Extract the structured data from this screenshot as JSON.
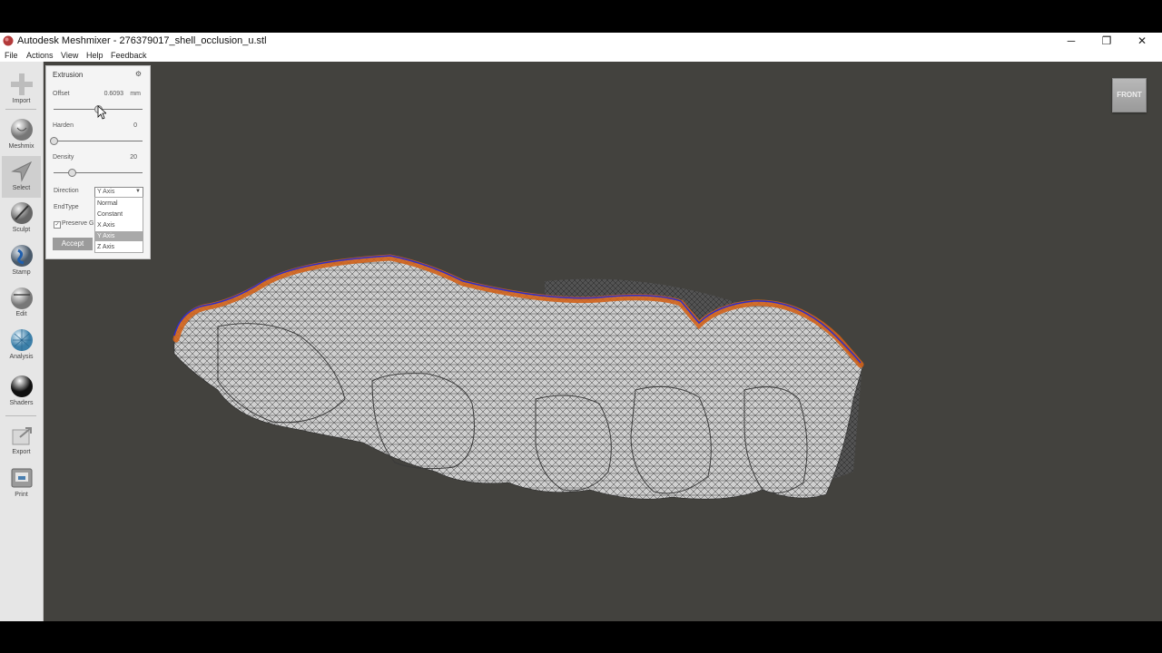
{
  "window": {
    "title": "Autodesk Meshmixer - 276379017_shell_occlusion_u.stl",
    "controls": {
      "minimize": "─",
      "restore": "❐",
      "close": "✕"
    }
  },
  "menu": [
    "File",
    "Actions",
    "View",
    "Help",
    "Feedback"
  ],
  "toolbar": [
    {
      "label": "Import",
      "icon": "plus-icon"
    },
    {
      "label": "Meshmix",
      "icon": "meshmix-sphere-icon"
    },
    {
      "label": "Select",
      "icon": "select-arrow-icon"
    },
    {
      "label": "Sculpt",
      "icon": "brush-icon"
    },
    {
      "label": "Stamp",
      "icon": "stamp-icon"
    },
    {
      "label": "Edit",
      "icon": "edit-sphere-icon"
    },
    {
      "label": "Analysis",
      "icon": "analysis-sphere-icon"
    },
    {
      "label": "Shaders",
      "icon": "shaders-sphere-icon"
    },
    {
      "label": "Export",
      "icon": "export-icon"
    },
    {
      "label": "Print",
      "icon": "printer-icon"
    }
  ],
  "panel": {
    "title": "Extrusion",
    "offset": {
      "label": "Offset",
      "value": "0.6093",
      "unit": "mm",
      "slider": 0.5
    },
    "harden": {
      "label": "Harden",
      "value": "0",
      "slider": 0.0
    },
    "density": {
      "label": "Density",
      "value": "20",
      "slider": 0.2
    },
    "direction": {
      "label": "Direction",
      "selected": "Y Axis",
      "options": [
        "Normal",
        "Constant",
        "X Axis",
        "Y Axis",
        "Z Axis"
      ]
    },
    "endtype": {
      "label": "EndType"
    },
    "preserve": {
      "label": "Preserve G"
    },
    "accept": "Accept"
  },
  "viewcube": {
    "label": "FRONT"
  },
  "colors": {
    "viewport": "#43423e",
    "selection": "#d0621a",
    "boundary": "#2e2ec8"
  }
}
